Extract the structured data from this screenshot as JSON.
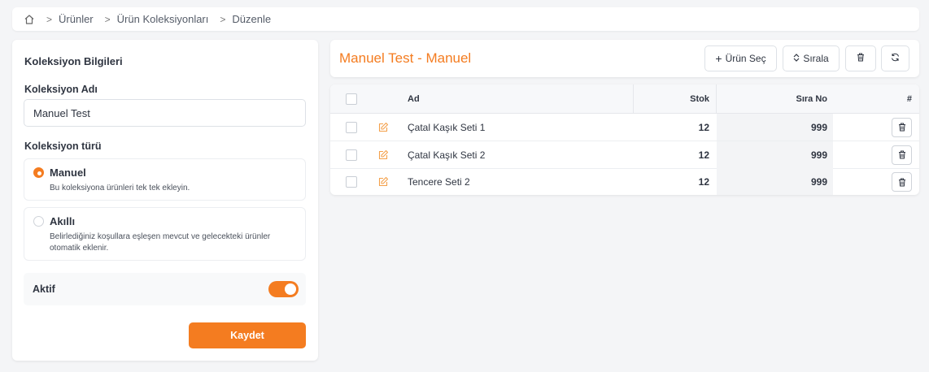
{
  "breadcrumb": {
    "items": [
      "Ürünler",
      "Ürün Koleksiyonları",
      "Düzenle"
    ]
  },
  "left": {
    "title": "Koleksiyon Bilgileri",
    "name_label": "Koleksiyon Adı",
    "name_value": "Manuel Test",
    "type_label": "Koleksiyon türü",
    "options": [
      {
        "title": "Manuel",
        "desc": "Bu koleksiyona ürünleri tek tek ekleyin.",
        "selected": true
      },
      {
        "title": "Akıllı",
        "desc": "Belirlediğiniz koşullara eşleşen mevcut ve gelecekteki ürünler otomatik eklenir.",
        "selected": false
      }
    ],
    "active_label": "Aktif",
    "active_on": true,
    "save_label": "Kaydet"
  },
  "right": {
    "title": "Manuel Test - Manuel",
    "btn_select": "Ürün Seç",
    "btn_sort": "Sırala",
    "table": {
      "headers": {
        "name": "Ad",
        "stock": "Stok",
        "order": "Sıra No",
        "hash": "#"
      },
      "rows": [
        {
          "name": "Çatal Kaşık Seti 1",
          "stock": "12",
          "order": "999"
        },
        {
          "name": "Çatal Kaşık Seti 2",
          "stock": "12",
          "order": "999"
        },
        {
          "name": "Tencere Seti 2",
          "stock": "12",
          "order": "999"
        }
      ]
    }
  },
  "colors": {
    "accent": "#f47c20",
    "background": "#f4f5f7",
    "text": "#2f3541"
  }
}
